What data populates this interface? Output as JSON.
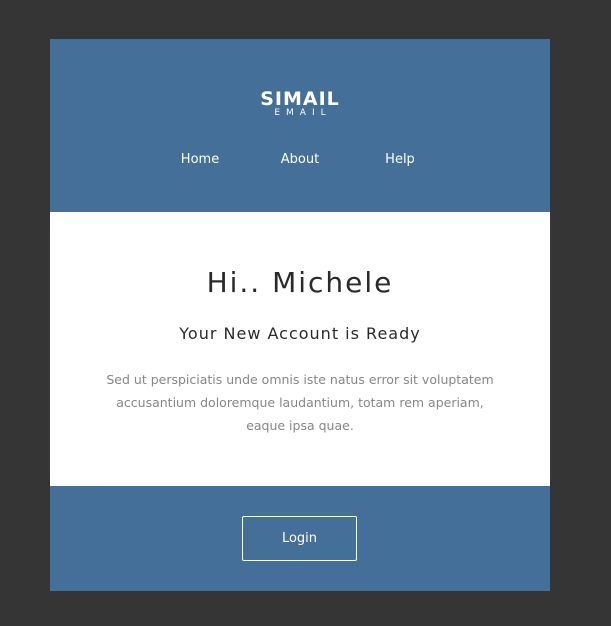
{
  "header": {
    "logo_main": "SIMAIL",
    "logo_sub": "EMAIL",
    "nav": [
      {
        "label": "Home"
      },
      {
        "label": "About"
      },
      {
        "label": "Help"
      }
    ]
  },
  "content": {
    "greeting": "Hi.. Michele",
    "subtitle": "Your New Account is Ready",
    "body": "Sed ut perspiciatis unde omnis iste natus error sit voluptatem accusantium doloremque laudantium, totam rem aperiam, eaque ipsa quae."
  },
  "footer": {
    "login_label": "Login"
  },
  "colors": {
    "background": "#353535",
    "brand_blue": "#436f99",
    "card": "#ffffff",
    "heading_text": "#2a2a2a",
    "body_text": "#868686"
  }
}
